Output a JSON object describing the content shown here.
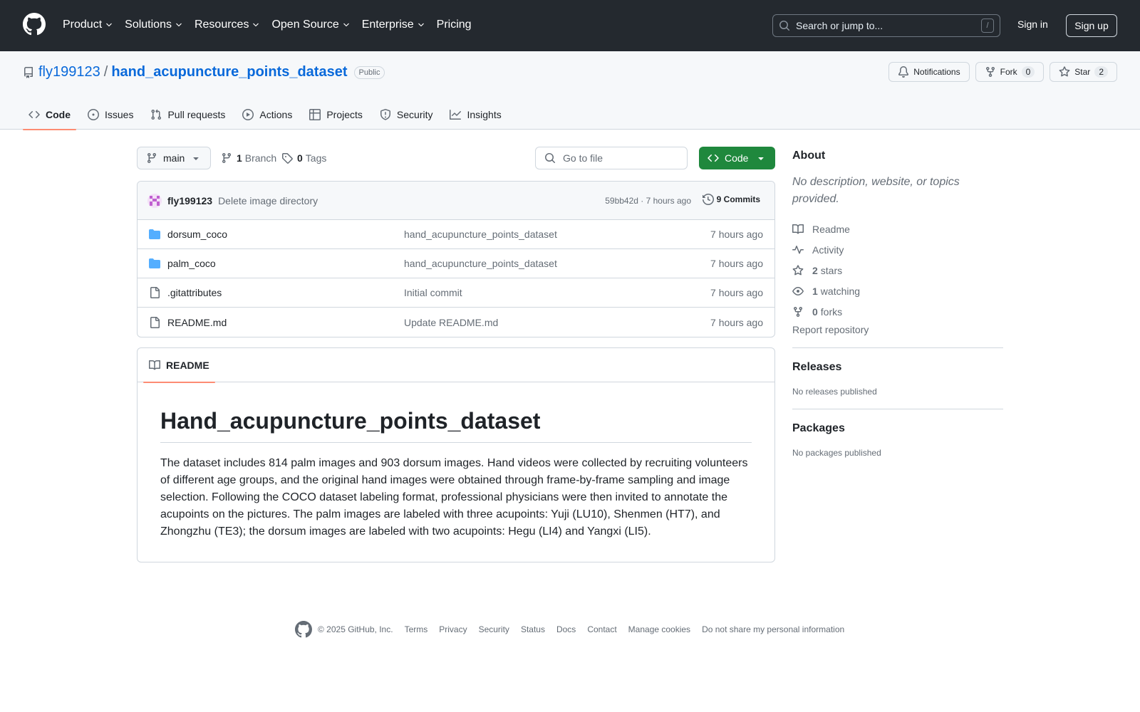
{
  "header": {
    "nav": [
      "Product",
      "Solutions",
      "Resources",
      "Open Source",
      "Enterprise",
      "Pricing"
    ],
    "search_placeholder": "Search or jump to...",
    "search_shortcut": "/",
    "sign_in": "Sign in",
    "sign_up": "Sign up"
  },
  "repo": {
    "owner": "fly199123",
    "separator": "/",
    "name": "hand_acupuncture_points_dataset",
    "visibility": "Public",
    "notifications_label": "Notifications",
    "fork_label": "Fork",
    "fork_count": "0",
    "star_label": "Star",
    "star_count": "2"
  },
  "tabs": [
    "Code",
    "Issues",
    "Pull requests",
    "Actions",
    "Projects",
    "Security",
    "Insights"
  ],
  "branch_bar": {
    "branch": "main",
    "branch_count": "1",
    "branch_label": "Branch",
    "tag_count": "0",
    "tag_label": "Tags",
    "goto_placeholder": "Go to file",
    "code_button": "Code"
  },
  "latest_commit": {
    "author": "fly199123",
    "message": "Delete image directory",
    "meta": "59bb42d · 7 hours ago",
    "commits_label": "9 Commits"
  },
  "files": [
    {
      "name": "dorsum_coco",
      "type": "dir",
      "message": "hand_acupuncture_points_dataset",
      "age": "7 hours ago"
    },
    {
      "name": "palm_coco",
      "type": "dir",
      "message": "hand_acupuncture_points_dataset",
      "age": "7 hours ago"
    },
    {
      "name": ".gitattributes",
      "type": "file",
      "message": "Initial commit",
      "age": "7 hours ago"
    },
    {
      "name": "README.md",
      "type": "file",
      "message": "Update README.md",
      "age": "7 hours ago"
    }
  ],
  "readme": {
    "tab_label": "README",
    "heading": "Hand_acupuncture_points_dataset",
    "body": "The dataset includes 814 palm images and 903 dorsum images. Hand videos were collected by recruiting volunteers of different age groups, and the original hand images were obtained through frame-by-frame sampling and image selection. Following the COCO dataset labeling format, professional physicians were then invited to annotate the acupoints on the pictures. The palm images are labeled with three acupoints: Yuji (LU10), Shenmen (HT7), and Zhongzhu (TE3); the dorsum images are labeled with two acupoints: Hegu (LI4) and Yangxi (LI5)."
  },
  "sidebar": {
    "about_title": "About",
    "about_desc": "No description, website, or topics provided.",
    "readme_label": "Readme",
    "activity_label": "Activity",
    "stars_count": "2",
    "stars_label": "stars",
    "watching_count": "1",
    "watching_label": "watching",
    "forks_count": "0",
    "forks_label": "forks",
    "report_label": "Report repository",
    "releases_title": "Releases",
    "releases_empty": "No releases published",
    "packages_title": "Packages",
    "packages_empty": "No packages published"
  },
  "footer": {
    "copyright": "© 2025 GitHub, Inc.",
    "links": [
      "Terms",
      "Privacy",
      "Security",
      "Status",
      "Docs",
      "Contact",
      "Manage cookies",
      "Do not share my personal information"
    ]
  },
  "colors": {
    "header_bg": "#24292f",
    "link_blue": "#0969da",
    "code_green": "#1f883d",
    "tab_underline": "#fd8c73",
    "folder_blue": "#54aeff"
  },
  "icons": [
    "github-mark-icon",
    "chevron-down-icon",
    "search-icon",
    "repo-icon",
    "bell-icon",
    "fork-icon",
    "star-icon",
    "code-icon",
    "issue-icon",
    "pull-request-icon",
    "play-icon",
    "table-icon",
    "shield-icon",
    "graph-icon",
    "branch-icon",
    "tag-icon",
    "history-icon",
    "folder-icon",
    "file-icon",
    "book-icon",
    "pulse-icon",
    "eye-icon"
  ]
}
